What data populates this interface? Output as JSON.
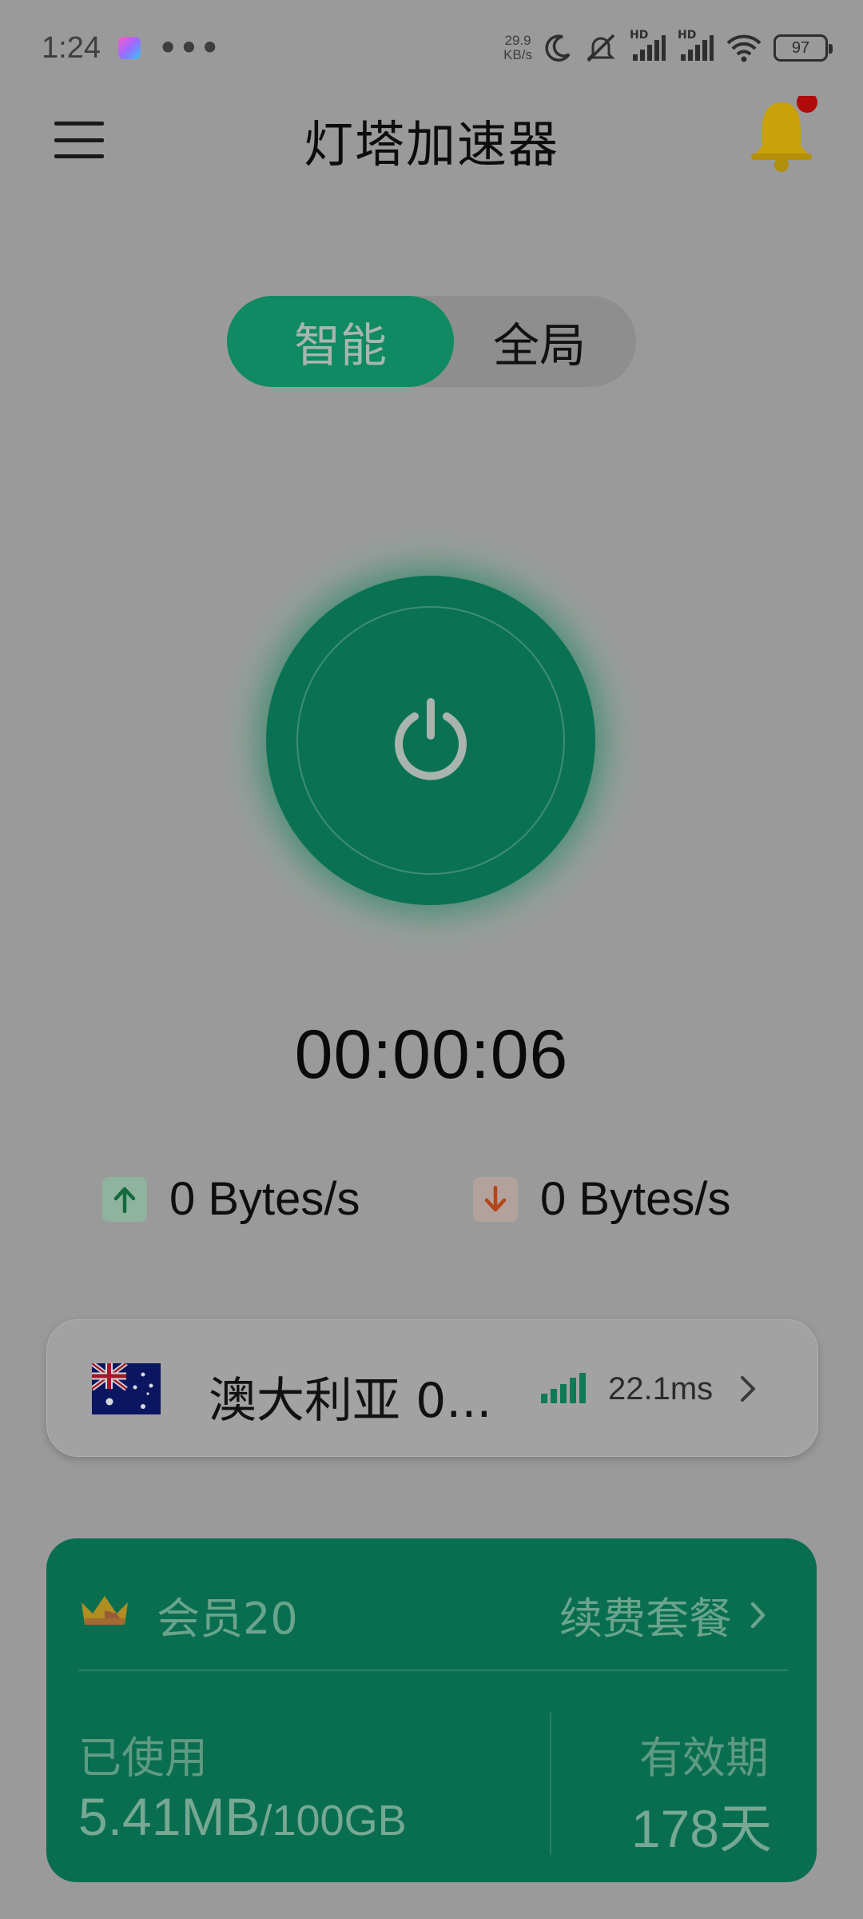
{
  "status_bar": {
    "time": "1:24",
    "dots": "•••",
    "net_speed_value": "29.9",
    "net_speed_unit": "KB/s",
    "hd_label": "HD",
    "battery": "97"
  },
  "header": {
    "title": "灯塔加速器"
  },
  "mode": {
    "smart_label": "智能",
    "global_label": "全局",
    "selected": "smart"
  },
  "connection": {
    "timer": "00:00:06",
    "upload_speed": "0 Bytes/s",
    "download_speed": "0 Bytes/s"
  },
  "server": {
    "name": "澳大利亚 0...",
    "latency": "22.1ms"
  },
  "membership": {
    "plan": "会员20",
    "renew_label": "续费套餐",
    "used_label": "已使用",
    "used_value": "5.41MB",
    "quota": "/100GB",
    "validity_label": "有效期",
    "validity_value": "178天"
  },
  "colors": {
    "accent": "#0f8a63",
    "card": "#096e50",
    "overlay_bg": "#9a9a9a"
  }
}
